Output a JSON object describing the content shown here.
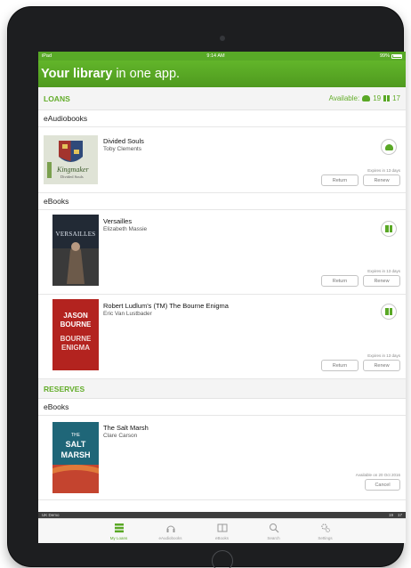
{
  "statusbar": {
    "carrier": "iPad",
    "time": "9:14 AM",
    "battery": "99%"
  },
  "header": {
    "title_bold": "Your library",
    "title_rest": "in one app."
  },
  "loans": {
    "heading": "LOANS",
    "available_label": "Available:",
    "available_audio": "19",
    "available_ebooks": "17",
    "eaudiobooks_heading": "eAudiobooks",
    "ebooks_heading": "eBooks",
    "items": [
      {
        "title": "Divided Souls",
        "author": "Toby Clements",
        "expires": "Expires in 13 days",
        "return": "Return",
        "renew": "Renew",
        "cover_title": "Kingmaker",
        "cover_sub": "Divided Souls"
      },
      {
        "title": "Versailles",
        "author": "Elizabeth Massie",
        "expires": "Expires in 13 days",
        "return": "Return",
        "renew": "Renew",
        "cover_title": "VERSAILLES"
      },
      {
        "title": "Robert Ludlum's (TM) The Bourne Enigma",
        "author": "Eric Van Lustbader",
        "expires": "Expires in 13 days",
        "return": "Return",
        "renew": "Renew",
        "cover_l1": "JASON",
        "cover_l2": "BOURNE",
        "cover_l3": "BOURNE",
        "cover_l4": "ENIGMA"
      }
    ]
  },
  "reserves": {
    "heading": "RESERVES",
    "ebooks_heading": "eBooks",
    "items": [
      {
        "title": "The Salt Marsh",
        "author": "Clare Carson",
        "available": "Available on 20 Oct 2016",
        "cancel": "Cancel",
        "cover_l1": "THE",
        "cover_l2": "SALT",
        "cover_l3": "MARSH"
      }
    ]
  },
  "footer": {
    "library": "UK Demo",
    "audio_count": "19",
    "ebook_count": "17"
  },
  "tabs": [
    {
      "label": "My Loans",
      "icon": "stack-icon",
      "active": true
    },
    {
      "label": "eAudiobooks",
      "icon": "headphones-icon",
      "active": false
    },
    {
      "label": "eBooks",
      "icon": "book-icon",
      "active": false
    },
    {
      "label": "Search",
      "icon": "search-icon",
      "active": false
    },
    {
      "label": "Settings",
      "icon": "gear-icon",
      "active": false
    }
  ],
  "colors": {
    "brand_green": "#58a927",
    "section_green": "#63ad2a"
  }
}
